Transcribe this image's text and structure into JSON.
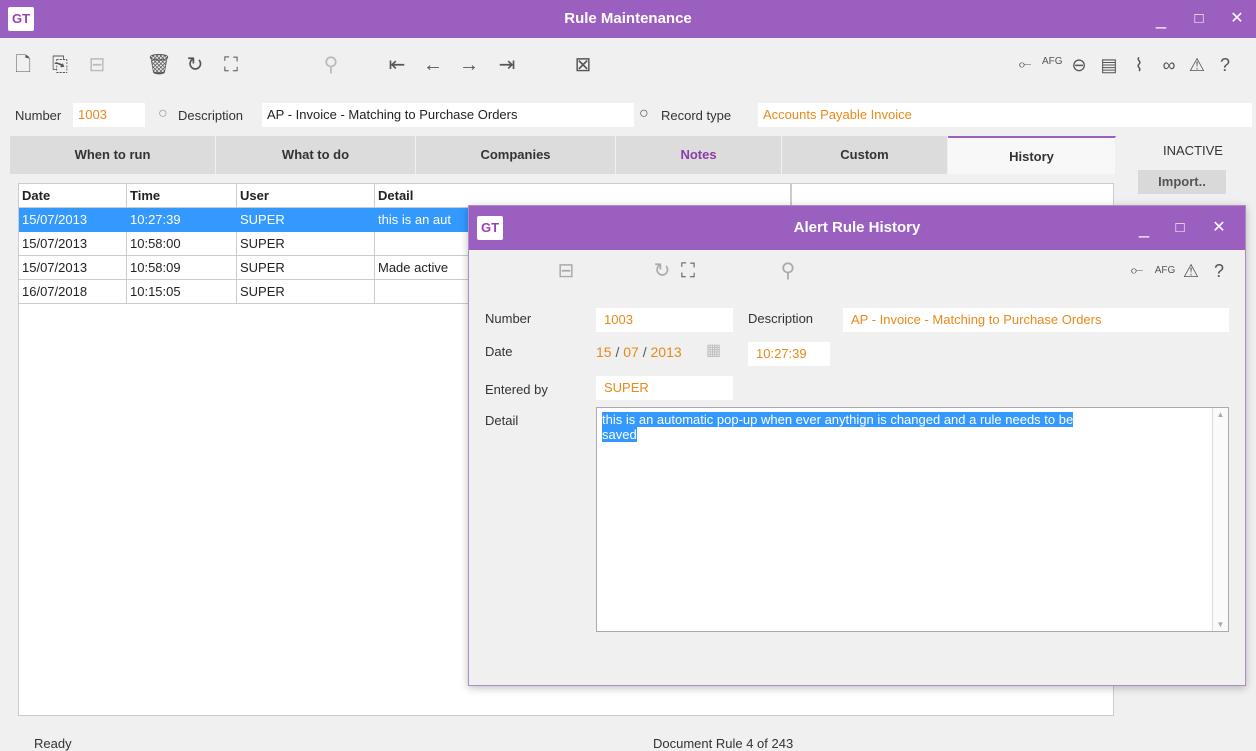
{
  "window": {
    "logo": "GT",
    "title": "Rule Maintenance",
    "minimize": "_",
    "maximize": "□",
    "close": "✕"
  },
  "toolbar": {
    "afg_label": "AFG"
  },
  "header": {
    "number_label": "Number",
    "number_value": "1003",
    "description_label": "Description",
    "description_value": "AP - Invoice - Matching to Purchase Orders",
    "record_type_label": "Record type",
    "record_type_value": "Accounts Payable Invoice"
  },
  "tabs": [
    {
      "label": "When to run"
    },
    {
      "label": "What to do"
    },
    {
      "label": "Companies"
    },
    {
      "label": "Notes"
    },
    {
      "label": "Custom"
    },
    {
      "label": "History"
    }
  ],
  "side": {
    "inactive_label": "INACTIVE",
    "import_label": "Import.."
  },
  "grid": {
    "columns": [
      "Date",
      "Time",
      "User",
      "Detail"
    ],
    "rows": [
      {
        "date": "15/07/2013",
        "time": "10:27:39",
        "user": "SUPER",
        "detail": "this is an aut"
      },
      {
        "date": "15/07/2013",
        "time": "10:58:00",
        "user": "SUPER",
        "detail": ""
      },
      {
        "date": "15/07/2013",
        "time": "10:58:09",
        "user": "SUPER",
        "detail": "Made active"
      },
      {
        "date": "16/07/2018",
        "time": "10:15:05",
        "user": "SUPER",
        "detail": ""
      }
    ]
  },
  "status": {
    "left": "Ready",
    "middle": "Document Rule 4 of 243"
  },
  "dialog": {
    "logo": "GT",
    "title": "Alert Rule History",
    "minimize": "_",
    "maximize": "□",
    "close": "✕",
    "afg_label": "AFG",
    "number_label": "Number",
    "number_value": "1003",
    "description_label": "Description",
    "description_value": "AP - Invoice - Matching to Purchase Orders",
    "date_label": "Date",
    "date_day": "15",
    "date_month": "07",
    "date_year": "2013",
    "date_sep": "/",
    "time_value": "10:27:39",
    "entered_by_label": "Entered by",
    "entered_by_value": "SUPER",
    "detail_label": "Detail",
    "detail_line1": "this is an automatic pop-up when ever anythign is changed and a rule needs to be",
    "detail_line2": "saved"
  }
}
